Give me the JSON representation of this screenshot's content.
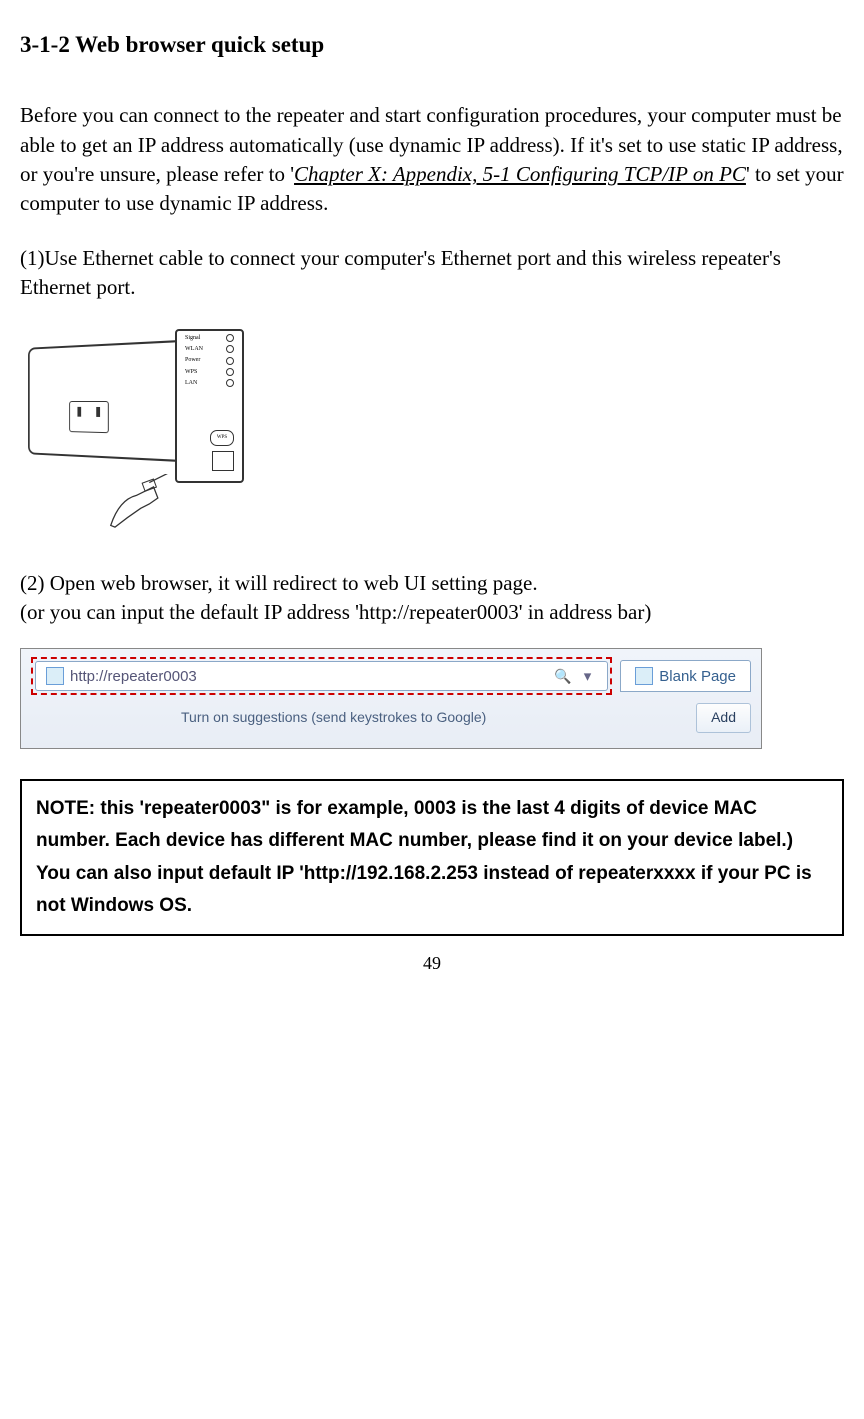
{
  "heading": "3-1-2 Web browser quick setup",
  "intro_before": "Before you can connect to the repeater and start configuration procedures, your computer must be able to get an IP address automatically (use dynamic IP address). If it's set to use static IP address, or you're unsure, please refer to '",
  "intro_link": "Chapter X: Appendix, 5-1 Configuring TCP/IP on PC",
  "intro_after": "' to set your computer to use dynamic IP address.",
  "step1": "(1)Use Ethernet cable to connect your computer's Ethernet port and this wireless repeater's Ethernet port.",
  "device": {
    "leds": [
      "Signal",
      "WLAN",
      "Power",
      "WPS",
      "LAN"
    ],
    "wps_button": "WPS"
  },
  "step2_line1": "(2) Open web browser, it will redirect to web UI setting page.",
  "step2_line2": "(or you can input the default IP address 'http://repeater0003' in address bar)",
  "browser": {
    "url": "http://repeater0003",
    "tab_label": "Blank Page",
    "suggestion_text": "Turn on suggestions (send keystrokes to Google)",
    "add_button": "Add"
  },
  "note": "NOTE: this 'repeater0003\" is for example, 0003 is the last 4 digits of device MAC number. Each device has different MAC number, please find it on your device label.) You can also input default IP 'http://192.168.2.253 instead of repeaterxxxx if your PC is not Windows OS.",
  "page_number": "49"
}
